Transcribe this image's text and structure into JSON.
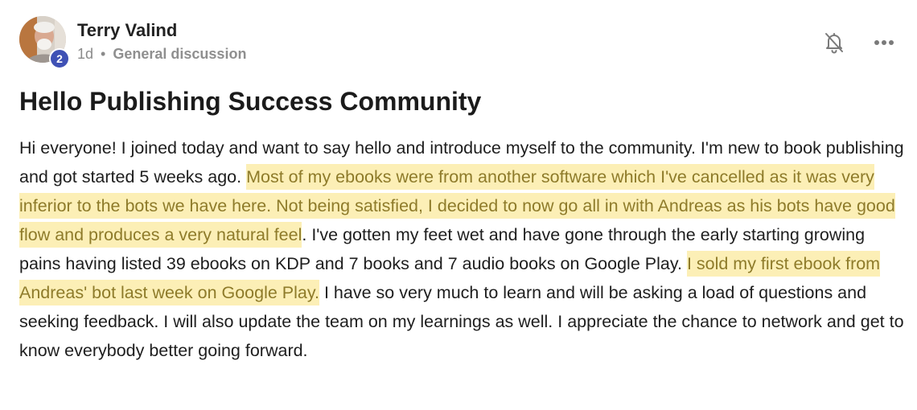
{
  "post": {
    "author": {
      "name": "Terry Valind",
      "level": "2",
      "avatar_icon": "user-avatar-photo"
    },
    "meta": {
      "time": "1d",
      "separator": "•",
      "category": "General discussion"
    },
    "actions": {
      "notify_icon": "bell-off-icon",
      "more_icon": "more-horizontal-icon"
    },
    "title": "Hello Publishing Success Community",
    "body": {
      "p1": "Hi everyone! I joined today and want to say hello and introduce myself to the community. I'm new to book publishing and got started 5 weeks ago. ",
      "h1": "Most of my ebooks were from another software which I've cancelled as it was very inferior to the bots we have here. Not being satisfied, I decided to now go all in with Andreas as his bots have good flow and produces a very natural feel",
      "p2": ". I've gotten my feet wet and have gone through the early starting growing pains having listed 39 ebooks on KDP and 7 books and 7 audio books on Google Play. ",
      "h2": "I sold my first ebook from Andreas' bot last week on Google Play.",
      "p3": " I have so very much to learn and will be asking a load of questions and seeking feedback. I will also update the team on my learnings as well. I appreciate the chance to network and get to know everybody better going forward."
    },
    "colors": {
      "highlight_bg": "#fcefb6",
      "highlight_text": "#8e7b2a",
      "badge": "#3f51b5",
      "meta_text": "#8a8a8a"
    }
  }
}
